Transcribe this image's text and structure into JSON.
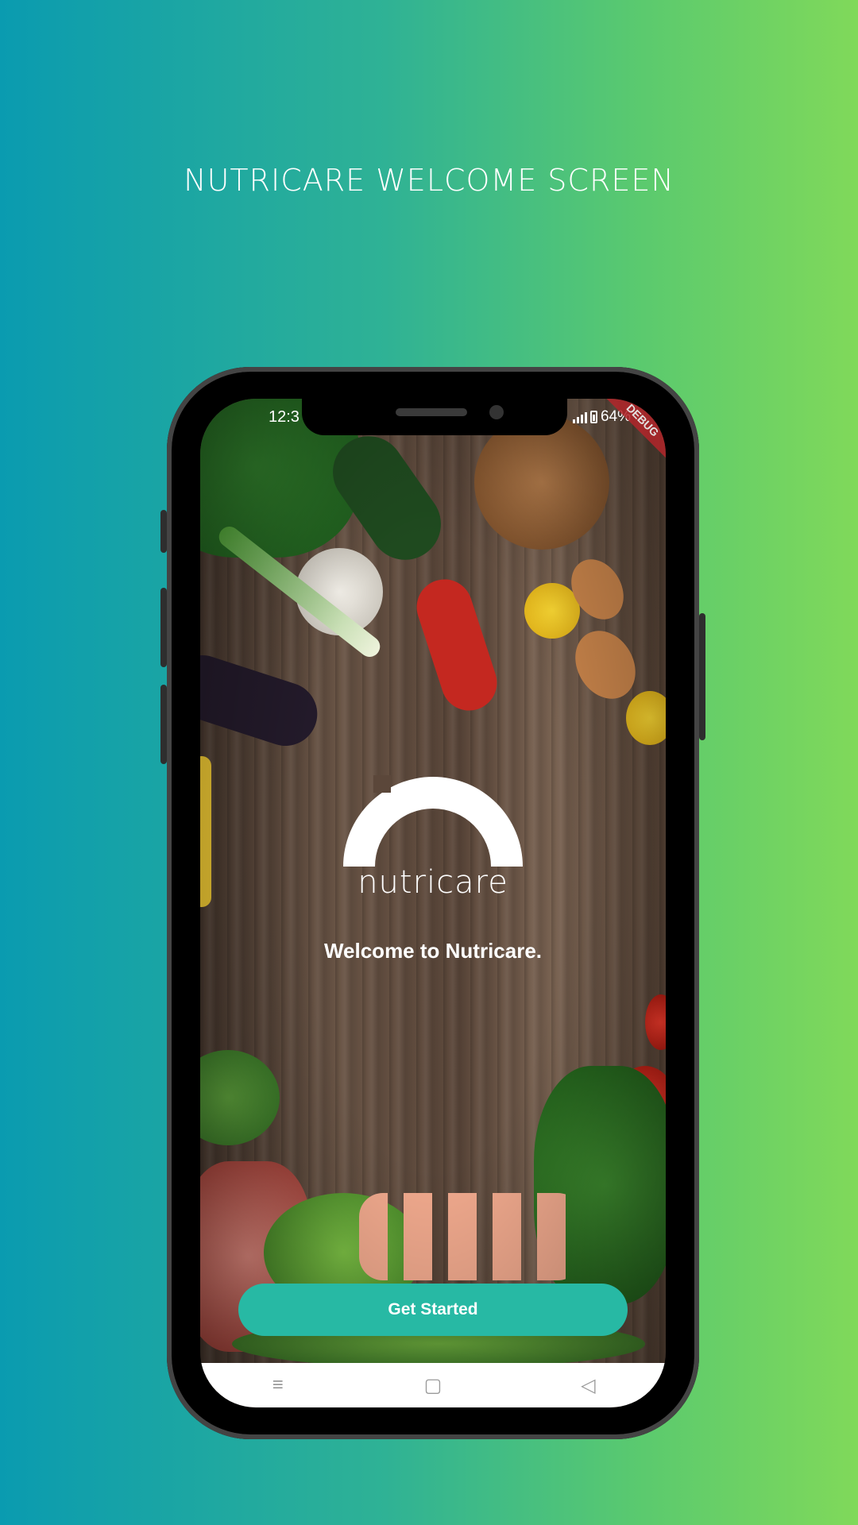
{
  "page": {
    "headline": "NUTRICARE WELCOME SCREEN",
    "background_colors": [
      "#0a9bb0",
      "#80d95a"
    ]
  },
  "status_bar": {
    "time": "12:3",
    "battery": "64%",
    "debug_badge": "DEBUG"
  },
  "app": {
    "logo_text": "nutricare",
    "welcome_message": "Welcome to Nutricare.",
    "cta_label": "Get Started",
    "accent_color": "#27b9a4"
  },
  "nav_bar": {
    "menu_icon": "≡",
    "home_icon": "▢",
    "back_icon": "◁"
  }
}
